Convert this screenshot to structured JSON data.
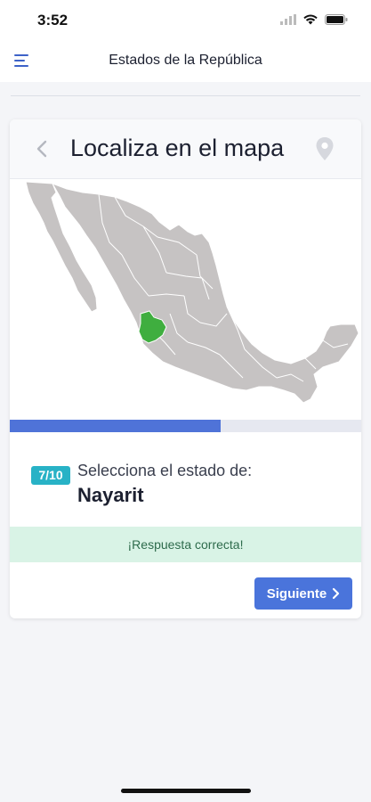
{
  "status_bar": {
    "time": "3:52",
    "icons": [
      "signal-icon",
      "wifi-icon",
      "battery-icon"
    ]
  },
  "nav": {
    "title": "Estados de la República",
    "menu_icon": "hamburger-menu-icon"
  },
  "card": {
    "title": "Localiza en el mapa",
    "back_icon": "chevron-left-icon",
    "pin_icon": "map-pin-icon"
  },
  "map": {
    "highlighted_state": "Nayarit",
    "base_color": "#c6c3c3",
    "highlight_color": "#3fae3f"
  },
  "progress": {
    "current": 7,
    "total": 10,
    "fraction": 0.6
  },
  "question": {
    "counter": "7/10",
    "prompt": "Selecciona el estado de:",
    "state": "Nayarit"
  },
  "feedback": {
    "text": "¡Respuesta correcta!"
  },
  "actions": {
    "next_label": "Siguiente"
  },
  "colors": {
    "accent": "#4a74db",
    "badge": "#28b2c6",
    "success_bg": "#d9f3e6"
  }
}
